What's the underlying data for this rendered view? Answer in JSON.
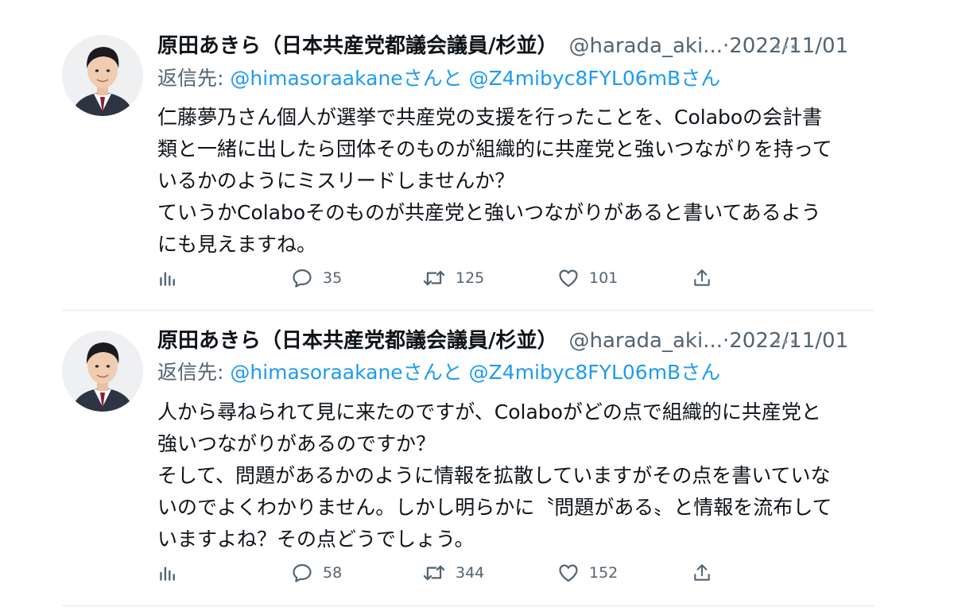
{
  "tweets": [
    {
      "name": "原田あきら（日本共産党都議会議員/杉並）",
      "handle": "@harada_aki...",
      "separator": "·",
      "date": "2022/11/01",
      "more_icon": "more-icon",
      "reply_label": "返信先:",
      "mention_1": "@himasoraakane",
      "reply_join": "さんと",
      "mention_2": "@Z4mibyc8FYL06mB",
      "reply_suffix": "さん",
      "body_text": "仁藤夢乃さん個人が選挙で共産党の支援を行ったことを、Colaboの会計書\n類と一緒に出したら団体そのものが組織的に共産党と強いつながりを持って\nいるかのようにミスリードしませんか？\nていうかColaboそのものが共産党と強いつながりがあると書いてあるよう\nにも見えますね。",
      "counts": {
        "replies": "35",
        "retweets": "125",
        "likes": "101"
      }
    },
    {
      "name": "原田あきら（日本共産党都議会議員/杉並）",
      "handle": "@harada_aki...",
      "separator": "·",
      "date": "2022/11/01",
      "more_icon": "more-icon",
      "reply_label": "返信先:",
      "mention_1": "@himasoraakane",
      "reply_join": "さんと",
      "mention_2": "@Z4mibyc8FYL06mB",
      "reply_suffix": "さん",
      "body_text": "人から尋ねられて見に来たのですが、Colaboがどの点で組織的に共産党と\n強いつながりがあるのですか？\nそして、問題があるかのように情報を拡散していますがその点を書いていな\nいのでよくわかりません。しかし明らかに〝問題がある〟と情報を流布して\nいますよね？その点どうでしょう。",
      "counts": {
        "replies": "58",
        "retweets": "344",
        "likes": "152"
      }
    }
  ],
  "icons": [
    "views-icon",
    "reply-icon",
    "retweet-icon",
    "like-icon",
    "share-icon",
    "more-icon"
  ],
  "colors": {
    "text": "#0f1419",
    "secondary": "#536471",
    "link": "#1d9bf0",
    "divider": "#e3e6e8"
  }
}
